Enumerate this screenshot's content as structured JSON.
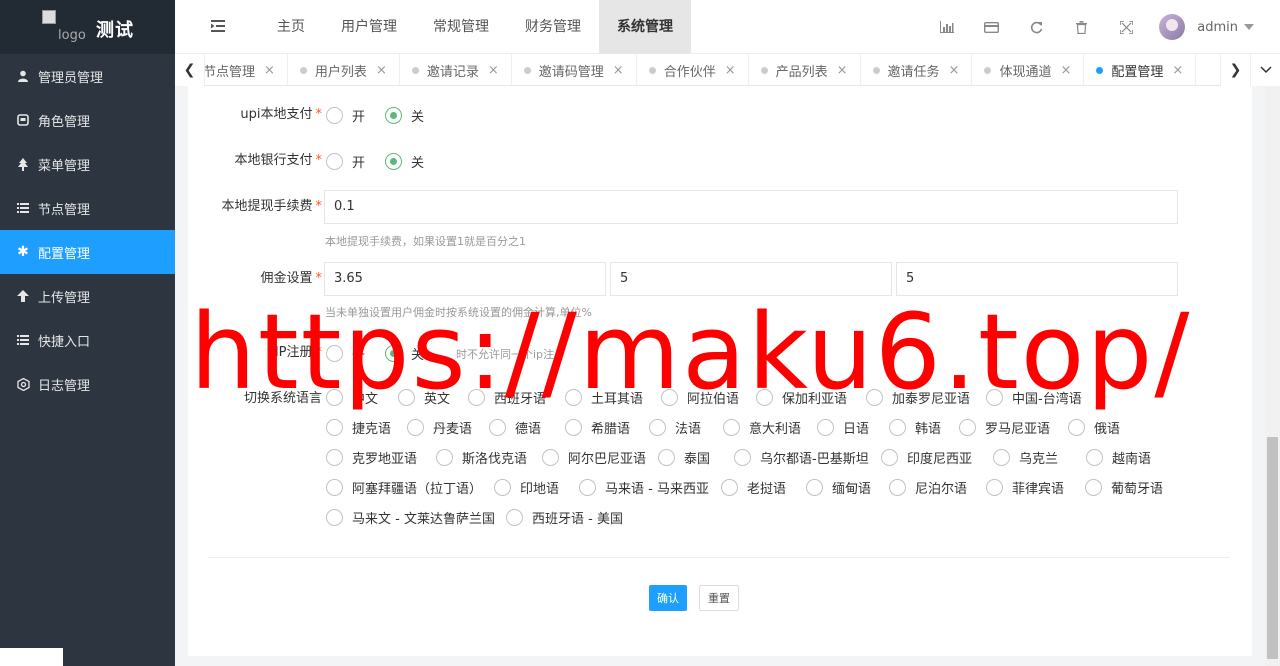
{
  "brand": {
    "logo_alt": "logo",
    "title": "测试"
  },
  "sidebar": {
    "items": [
      {
        "label": "管理员管理",
        "icon": "user-icon"
      },
      {
        "label": "角色管理",
        "icon": "role-icon"
      },
      {
        "label": "菜单管理",
        "icon": "tree-icon"
      },
      {
        "label": "节点管理",
        "icon": "list-icon"
      },
      {
        "label": "配置管理",
        "icon": "gear-icon",
        "active": true
      },
      {
        "label": "上传管理",
        "icon": "upload-icon"
      },
      {
        "label": "快捷入口",
        "icon": "list-icon"
      },
      {
        "label": "日志管理",
        "icon": "log-icon"
      }
    ]
  },
  "header": {
    "nav": [
      "主页",
      "用户管理",
      "常规管理",
      "财务管理",
      "系统管理"
    ],
    "active_nav": "系统管理",
    "tools": [
      "chart-icon",
      "card-icon",
      "refresh-icon",
      "trash-icon",
      "fullscreen-icon"
    ],
    "username": "admin"
  },
  "tabs": [
    {
      "label": "代理节点管理"
    },
    {
      "label": "用户列表"
    },
    {
      "label": "邀请记录"
    },
    {
      "label": "邀请码管理"
    },
    {
      "label": "合作伙伴"
    },
    {
      "label": "产品列表"
    },
    {
      "label": "邀请任务"
    },
    {
      "label": "体现通道"
    },
    {
      "label": "配置管理",
      "active": true
    }
  ],
  "form": {
    "upi": {
      "label": "upi本地支付",
      "on": "开",
      "off": "关",
      "value": "关"
    },
    "bank": {
      "label": "本地银行支付",
      "on": "开",
      "off": "关",
      "value": "关"
    },
    "fee": {
      "label": "本地提现手续费",
      "value": "0.1",
      "hint": "本地提现手续费，如果设置1就是百分之1"
    },
    "commission": {
      "label": "佣金设置",
      "values": [
        "3.65",
        "5",
        "5"
      ],
      "hint": "当未单独设置用户佣金时按系统设置的佣金计算,单位%"
    },
    "ip": {
      "label": "IP注册",
      "on": "开",
      "off": "关",
      "value": "关",
      "hint_partial": "时不允许同一个ip注"
    },
    "languages": {
      "label": "切换系统语言",
      "options": [
        "中文",
        "英文",
        "西班牙语",
        "土耳其语",
        "阿拉伯语",
        "保加利亚语",
        "加泰罗尼亚语",
        "中国-台湾语",
        "捷克语",
        "丹麦语",
        "德语",
        "希腊语",
        "法语",
        "意大利语",
        "日语",
        "韩语",
        "罗马尼亚语",
        "俄语",
        "克罗地亚语",
        "斯洛伐克语",
        "阿尔巴尼亚语",
        "泰国",
        "乌尔都语-巴基斯坦",
        "印度尼西亚",
        "乌克兰",
        "越南语",
        "阿塞拜疆语（拉丁语）",
        "印地语",
        "马来语 - 马来西亚",
        "老挝语",
        "缅甸语",
        "尼泊尔语",
        "菲律宾语",
        "葡萄牙语",
        "马来文 - 文莱达鲁萨兰国",
        "西班牙语 - 美国"
      ]
    },
    "submit": "确认",
    "reset": "重置"
  },
  "watermark": "https://maku6.top/",
  "colors": {
    "accent": "#1e9fff",
    "radio_on": "#5fb878",
    "sidebar_bg": "#2c3540",
    "required": "#ff5722"
  }
}
